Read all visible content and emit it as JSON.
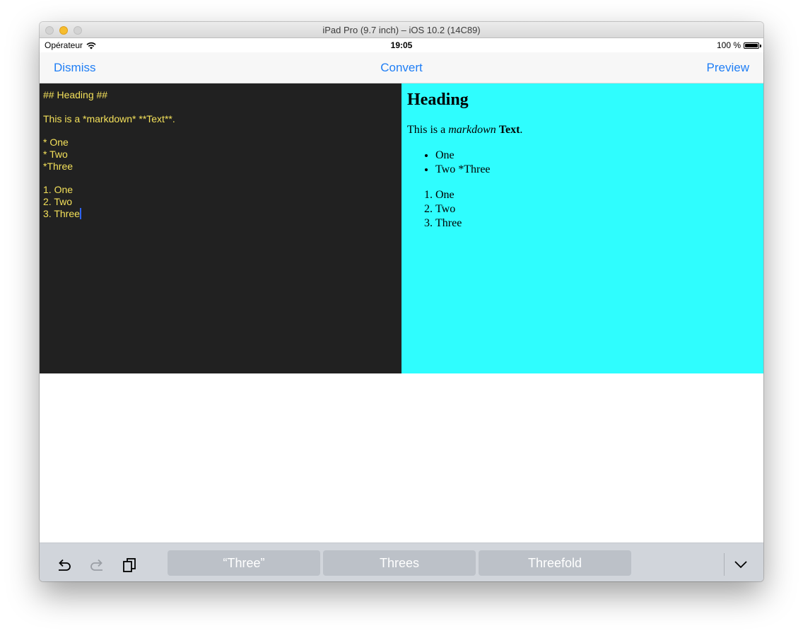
{
  "window": {
    "title": "iPad Pro (9.7 inch) – iOS 10.2 (14C89)"
  },
  "status_bar": {
    "carrier": "Opérateur",
    "time": "19:05",
    "battery": "100 %"
  },
  "nav": {
    "dismiss": "Dismiss",
    "convert": "Convert",
    "preview": "Preview",
    "tint": "#1f7ef5"
  },
  "editor": {
    "background": "#212121",
    "text_color": "#f3e05a",
    "lines": [
      "## Heading ##",
      "",
      "This is a *markdown* **Text**.",
      "",
      "* One",
      "* Two",
      "*Three",
      "",
      "1. One",
      "2. Two",
      "3. Three"
    ]
  },
  "preview": {
    "background": "#2ffdfe",
    "heading": "Heading",
    "paragraph": {
      "before": "This is a ",
      "italic": "markdown",
      "space": " ",
      "bold": "Text",
      "after": "."
    },
    "bullets": [
      "One",
      "Two *Three"
    ],
    "ordered": [
      "One",
      "Two",
      "Three"
    ]
  },
  "keyboard_bar": {
    "tools": [
      "undo-icon",
      "redo-icon",
      "paste-icon"
    ],
    "suggestions": [
      "“Three”",
      "Threes",
      "Threefold"
    ],
    "dismiss_icon": "chevron-down-icon"
  }
}
